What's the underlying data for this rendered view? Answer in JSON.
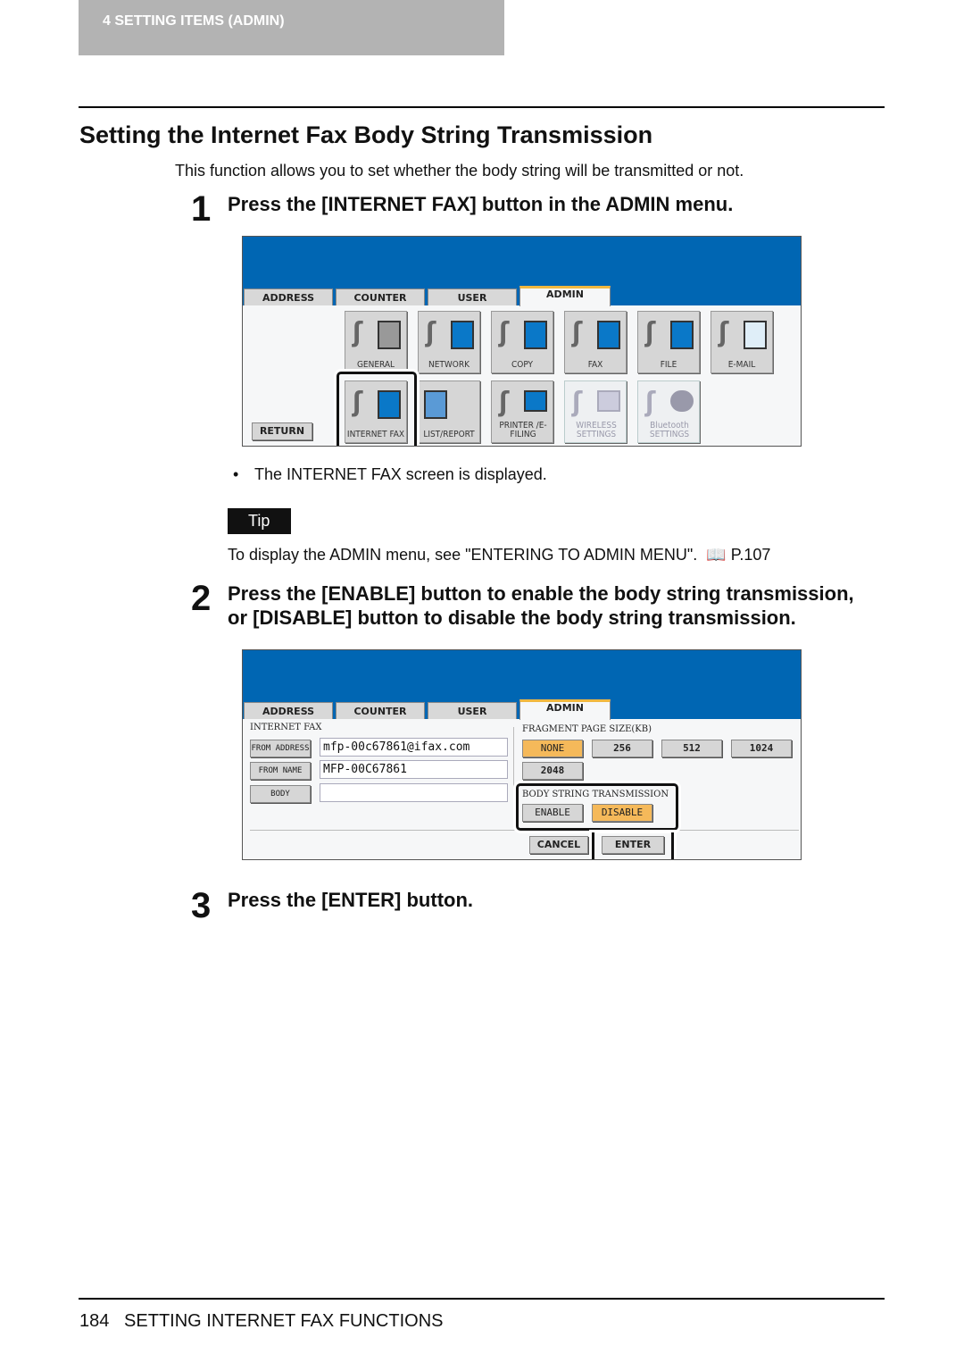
{
  "header": {
    "chapter": "4   SETTING ITEMS (ADMIN)"
  },
  "title": "Setting the Internet Fax Body String Transmission",
  "intro": "This function allows you to set whether the body string will be transmitted or not.",
  "steps": [
    {
      "number": "1",
      "text": "Press the [INTERNET FAX] button in the ADMIN menu."
    },
    {
      "number": "2",
      "text_line1": "Press the [ENABLE] button to enable the body string transmission,",
      "text_line2": "or [DISABLE] button to disable the body string transmission."
    },
    {
      "number": "3",
      "text": "Press the [ENTER] button."
    }
  ],
  "screen1": {
    "tabs": [
      "ADDRESS",
      "COUNTER",
      "USER",
      "ADMIN"
    ],
    "buttons": [
      "GENERAL",
      "NETWORK",
      "COPY",
      "FAX",
      "FILE",
      "E-MAIL",
      "INTERNET FAX",
      "LIST/REPORT",
      "PRINTER /E-FILING",
      "WIRELESS SETTINGS",
      "Bluetooth SETTINGS"
    ],
    "return": "RETURN"
  },
  "bullet": "The INTERNET FAX screen is displayed.",
  "tip": {
    "label": "Tip",
    "text": "To display the ADMIN menu, see \"ENTERING TO ADMIN MENU\".",
    "ref": "P.107"
  },
  "screen2": {
    "tabs": [
      "ADDRESS",
      "COUNTER",
      "USER",
      "ADMIN"
    ],
    "section": "INTERNET FAX",
    "from_address_label": "FROM ADDRESS",
    "from_address": "mfp-00c67861@ifax.com",
    "from_name_label": "FROM NAME",
    "from_name": "MFP-00C67861",
    "body_label": "BODY",
    "body": "",
    "fragment_label": "FRAGMENT PAGE SIZE(KB)",
    "fragment_options": [
      "NONE",
      "256",
      "512",
      "1024",
      "2048"
    ],
    "fragment_selected": "NONE",
    "body_string_label": "BODY STRING TRANSMISSION",
    "enable": "ENABLE",
    "disable": "DISABLE",
    "body_string_selected": "DISABLE",
    "cancel": "CANCEL",
    "enter": "ENTER"
  },
  "footer": {
    "page": "184",
    "section": "SETTING INTERNET FAX FUNCTIONS"
  },
  "colors": {
    "screen_blue": "#0066b3",
    "selected": "#f5b95a"
  }
}
